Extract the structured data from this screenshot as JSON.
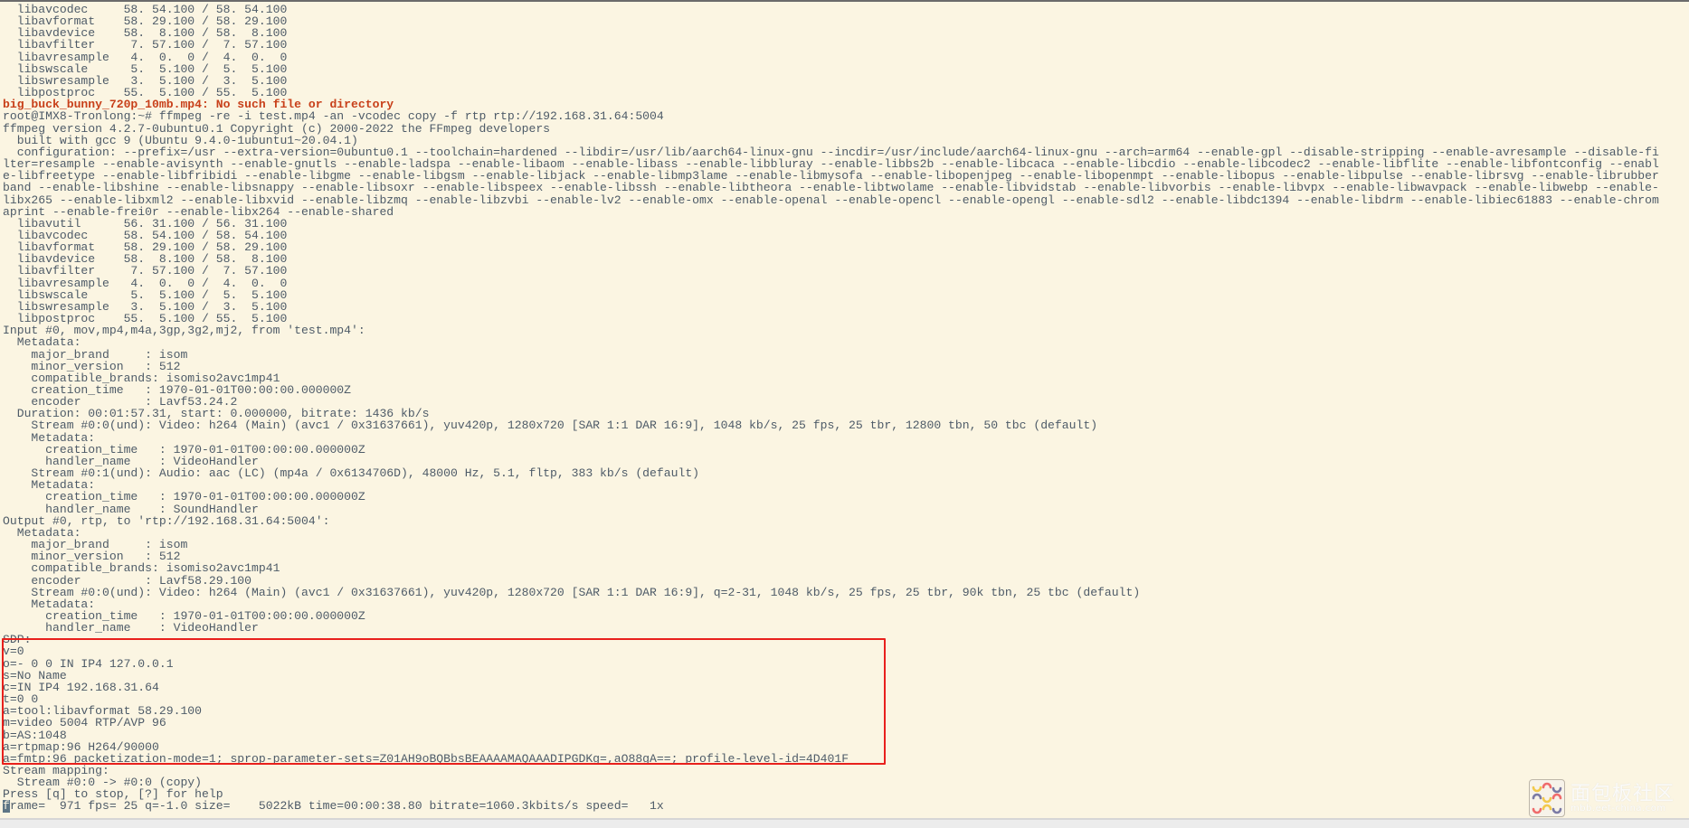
{
  "terminal": {
    "lines": [
      {
        "text": "  libavcodec     58. 54.100 / 58. 54.100"
      },
      {
        "text": "  libavformat    58. 29.100 / 58. 29.100"
      },
      {
        "text": "  libavdevice    58.  8.100 / 58.  8.100"
      },
      {
        "text": "  libavfilter     7. 57.100 /  7. 57.100"
      },
      {
        "text": "  libavresample   4.  0.  0 /  4.  0.  0"
      },
      {
        "text": "  libswscale      5.  5.100 /  5.  5.100"
      },
      {
        "text": "  libswresample   3.  5.100 /  3.  5.100"
      },
      {
        "text": "  libpostproc    55.  5.100 / 55.  5.100"
      },
      {
        "text": "big_buck_bunny_720p_10mb.mp4: No such file or directory",
        "error": true
      },
      {
        "text": "root@IMX8-Tronlong:~# ffmpeg -re -i test.mp4 -an -vcodec copy -f rtp rtp://192.168.31.64:5004"
      },
      {
        "text": "ffmpeg version 4.2.7-0ubuntu0.1 Copyright (c) 2000-2022 the FFmpeg developers"
      },
      {
        "text": "  built with gcc 9 (Ubuntu 9.4.0-1ubuntu1~20.04.1)"
      },
      {
        "text": "  configuration: --prefix=/usr --extra-version=0ubuntu0.1 --toolchain=hardened --libdir=/usr/lib/aarch64-linux-gnu --incdir=/usr/include/aarch64-linux-gnu --arch=arm64 --enable-gpl --disable-stripping --enable-avresample --disable-fi"
      },
      {
        "text": "lter=resample --enable-avisynth --enable-gnutls --enable-ladspa --enable-libaom --enable-libass --enable-libbluray --enable-libbs2b --enable-libcaca --enable-libcdio --enable-libcodec2 --enable-libflite --enable-libfontconfig --enabl"
      },
      {
        "text": "e-libfreetype --enable-libfribidi --enable-libgme --enable-libgsm --enable-libjack --enable-libmp3lame --enable-libmysofa --enable-libopenjpeg --enable-libopenmpt --enable-libopus --enable-libpulse --enable-librsvg --enable-librubber"
      },
      {
        "text": "band --enable-libshine --enable-libsnappy --enable-libsoxr --enable-libspeex --enable-libssh --enable-libtheora --enable-libtwolame --enable-libvidstab --enable-libvorbis --enable-libvpx --enable-libwavpack --enable-libwebp --enable-"
      },
      {
        "text": "libx265 --enable-libxml2 --enable-libxvid --enable-libzmq --enable-libzvbi --enable-lv2 --enable-omx --enable-openal --enable-opencl --enable-opengl --enable-sdl2 --enable-libdc1394 --enable-libdrm --enable-libiec61883 --enable-chrom"
      },
      {
        "text": "aprint --enable-frei0r --enable-libx264 --enable-shared"
      },
      {
        "text": "  libavutil      56. 31.100 / 56. 31.100"
      },
      {
        "text": "  libavcodec     58. 54.100 / 58. 54.100"
      },
      {
        "text": "  libavformat    58. 29.100 / 58. 29.100"
      },
      {
        "text": "  libavdevice    58.  8.100 / 58.  8.100"
      },
      {
        "text": "  libavfilter     7. 57.100 /  7. 57.100"
      },
      {
        "text": "  libavresample   4.  0.  0 /  4.  0.  0"
      },
      {
        "text": "  libswscale      5.  5.100 /  5.  5.100"
      },
      {
        "text": "  libswresample   3.  5.100 /  3.  5.100"
      },
      {
        "text": "  libpostproc    55.  5.100 / 55.  5.100"
      },
      {
        "text": "Input #0, mov,mp4,m4a,3gp,3g2,mj2, from 'test.mp4':"
      },
      {
        "text": "  Metadata:"
      },
      {
        "text": "    major_brand     : isom"
      },
      {
        "text": "    minor_version   : 512"
      },
      {
        "text": "    compatible_brands: isomiso2avc1mp41"
      },
      {
        "text": "    creation_time   : 1970-01-01T00:00:00.000000Z"
      },
      {
        "text": "    encoder         : Lavf53.24.2"
      },
      {
        "text": "  Duration: 00:01:57.31, start: 0.000000, bitrate: 1436 kb/s"
      },
      {
        "text": "    Stream #0:0(und): Video: h264 (Main) (avc1 / 0x31637661), yuv420p, 1280x720 [SAR 1:1 DAR 16:9], 1048 kb/s, 25 fps, 25 tbr, 12800 tbn, 50 tbc (default)"
      },
      {
        "text": "    Metadata:"
      },
      {
        "text": "      creation_time   : 1970-01-01T00:00:00.000000Z"
      },
      {
        "text": "      handler_name    : VideoHandler"
      },
      {
        "text": "    Stream #0:1(und): Audio: aac (LC) (mp4a / 0x6134706D), 48000 Hz, 5.1, fltp, 383 kb/s (default)"
      },
      {
        "text": "    Metadata:"
      },
      {
        "text": "      creation_time   : 1970-01-01T00:00:00.000000Z"
      },
      {
        "text": "      handler_name    : SoundHandler"
      },
      {
        "text": "Output #0, rtp, to 'rtp://192.168.31.64:5004':"
      },
      {
        "text": "  Metadata:"
      },
      {
        "text": "    major_brand     : isom"
      },
      {
        "text": "    minor_version   : 512"
      },
      {
        "text": "    compatible_brands: isomiso2avc1mp41"
      },
      {
        "text": "    encoder         : Lavf58.29.100"
      },
      {
        "text": "    Stream #0:0(und): Video: h264 (Main) (avc1 / 0x31637661), yuv420p, 1280x720 [SAR 1:1 DAR 16:9], q=2-31, 1048 kb/s, 25 fps, 25 tbr, 90k tbn, 25 tbc (default)"
      },
      {
        "text": "    Metadata:"
      },
      {
        "text": "      creation_time   : 1970-01-01T00:00:00.000000Z"
      },
      {
        "text": "      handler_name    : VideoHandler"
      },
      {
        "text": "SDP:"
      },
      {
        "text": "v=0"
      },
      {
        "text": "o=- 0 0 IN IP4 127.0.0.1"
      },
      {
        "text": "s=No Name"
      },
      {
        "text": "c=IN IP4 192.168.31.64"
      },
      {
        "text": "t=0 0"
      },
      {
        "text": "a=tool:libavformat 58.29.100"
      },
      {
        "text": "m=video 5004 RTP/AVP 96"
      },
      {
        "text": "b=AS:1048"
      },
      {
        "text": "a=rtpmap:96 H264/90000"
      },
      {
        "text": "a=fmtp:96 packetization-mode=1; sprop-parameter-sets=Z01AH9oBQBbsBEAAAAMAQAAADIPGDKg=,aO88gA==; profile-level-id=4D401F"
      },
      {
        "text": "Stream mapping:"
      },
      {
        "text": "  Stream #0:0 -> #0:0 (copy)"
      },
      {
        "text": "Press [q] to stop, [?] for help"
      },
      {
        "text": "frame=  971 fps= 25 q=-1.0 size=    5022kB time=00:00:38.80 bitrate=1060.3kbits/s speed=   1x",
        "cursor": true
      }
    ]
  },
  "highlight": {
    "color": "#e8201c"
  },
  "colors": {
    "background": "#fbf5e2",
    "text": "#4e5b68",
    "error": "#c8401a"
  },
  "watermark": {
    "title": "面包板社区",
    "url": "mbb.eet-china.com"
  }
}
